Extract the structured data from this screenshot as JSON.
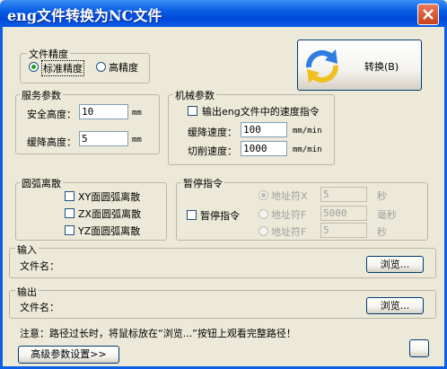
{
  "window": {
    "title": "eng文件转换为NC文件"
  },
  "convert_button": {
    "label": "转换(B)"
  },
  "file_precision": {
    "legend": "文件精度",
    "options": [
      {
        "label": "标准精度",
        "selected": true
      },
      {
        "label": "高精度",
        "selected": false
      }
    ]
  },
  "service_params": {
    "legend": "服务参数",
    "safe_height_label": "安全高度：",
    "safe_height_value": "10",
    "safe_height_unit": "mm",
    "descend_height_label": "缓降高度：",
    "descend_height_value": "5",
    "descend_height_unit": "mm"
  },
  "machine_params": {
    "legend": "机械参数",
    "output_speed_label": "输出eng文件中的速度指令",
    "output_speed_checked": false,
    "descend_speed_label": "缓降速度：",
    "descend_speed_value": "100",
    "descend_speed_unit": "mm/min",
    "cut_speed_label": "切削速度：",
    "cut_speed_value": "1000",
    "cut_speed_unit": "mm/min"
  },
  "arc_discrete": {
    "legend": "圆弧离散",
    "items": [
      {
        "label": "XY面圆弧离散",
        "checked": false
      },
      {
        "label": "ZX面圆弧离散",
        "checked": false
      },
      {
        "label": "YZ面圆弧离散",
        "checked": false
      }
    ]
  },
  "pause_cmd": {
    "legend": "暂停指令",
    "checkbox_label": "暂停指令",
    "checked": false,
    "options": [
      {
        "label": "地址符X",
        "value": "5",
        "unit": "秒"
      },
      {
        "label": "地址符F",
        "value": "5000",
        "unit": "毫秒"
      },
      {
        "label": "地址符F",
        "value": "5",
        "unit": "秒"
      }
    ]
  },
  "input_section": {
    "legend": "输入",
    "filename_label": "文件名：",
    "browse_label": "浏览..."
  },
  "output_section": {
    "legend": "输出",
    "filename_label": "文件名：",
    "browse_label": "浏览..."
  },
  "note": "注意：路径过长时，将鼠标放在“浏览...”按钮上观看完整路径！",
  "advanced_button": {
    "label": "高级参数设置>>"
  }
}
